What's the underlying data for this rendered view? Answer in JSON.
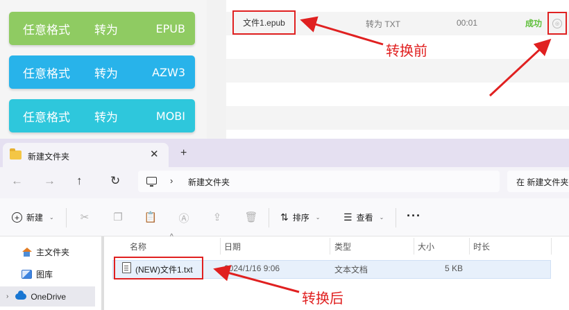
{
  "converter": {
    "buttons": [
      {
        "label": "任意格式",
        "middle": "转为",
        "format": "EPUB"
      },
      {
        "label": "任意格式",
        "middle": "转为",
        "format": "AZW3"
      },
      {
        "label": "任意格式",
        "middle": "转为",
        "format": "MOBI"
      }
    ],
    "task": {
      "file_name": "文件1.epub",
      "operation": "转为 TXT",
      "time": "00:01",
      "status": "成功",
      "status_icon": "open-folder-icon"
    },
    "colors": {
      "epub": "#8fcb62",
      "azw3": "#28b3ea",
      "mobi": "#2ec7dc",
      "success": "#5fbf3a",
      "annotation": "#e02020"
    }
  },
  "annotations": {
    "before": "转换前",
    "after": "转换后"
  },
  "explorer": {
    "tab": {
      "title": "新建文件夹",
      "close": "✕",
      "new_tab": "+"
    },
    "address": {
      "current": "新建文件夹",
      "search_placeholder": "在 新建文件夹 中搜索"
    },
    "toolbar": {
      "new_label": "新建",
      "sort_label": "排序",
      "view_label": "查看",
      "more": "···"
    },
    "nav": {
      "home": "主文件夹",
      "gallery": "图库",
      "onedrive": "OneDrive"
    },
    "columns": [
      "名称",
      "日期",
      "类型",
      "大小",
      "时长"
    ],
    "files": [
      {
        "name": "(NEW)文件1.txt",
        "date": "2024/1/16 9:06",
        "type": "文本文档",
        "size": "5 KB"
      }
    ]
  }
}
